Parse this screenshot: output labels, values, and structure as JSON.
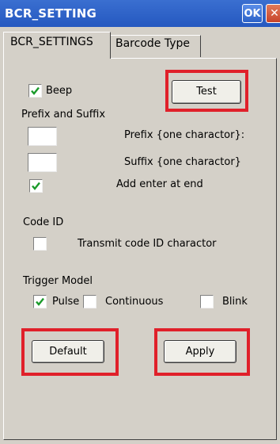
{
  "window": {
    "title": "BCR_SETTING",
    "ok_label": "OK",
    "close_label": "✕"
  },
  "tabs": [
    {
      "label": "BCR_SETTINGS",
      "active": true
    },
    {
      "label": "Barcode Type",
      "active": false
    }
  ],
  "beep": {
    "label": "Beep",
    "checked": true
  },
  "test_button": "Test",
  "prefix_suffix": {
    "heading": "Prefix and Suffix",
    "prefix_label": "Prefix {one charactor}:",
    "prefix_value": "",
    "suffix_label": "Suffix {one charactor}",
    "suffix_value": "",
    "add_enter_label": "Add enter at end",
    "add_enter_checked": true
  },
  "code_id": {
    "heading": "Code ID",
    "transmit_label": "Transmit code ID charactor",
    "transmit_checked": false
  },
  "trigger": {
    "heading": "Trigger Model",
    "options": [
      {
        "label": "Pulse",
        "checked": true
      },
      {
        "label": "Continuous",
        "checked": false
      },
      {
        "label": "Blink",
        "checked": false
      }
    ]
  },
  "default_button": "Default",
  "apply_button": "Apply",
  "colors": {
    "titlebar": "#2b5fc8",
    "highlight": "#e0202a",
    "face": "#d4d0c8"
  }
}
